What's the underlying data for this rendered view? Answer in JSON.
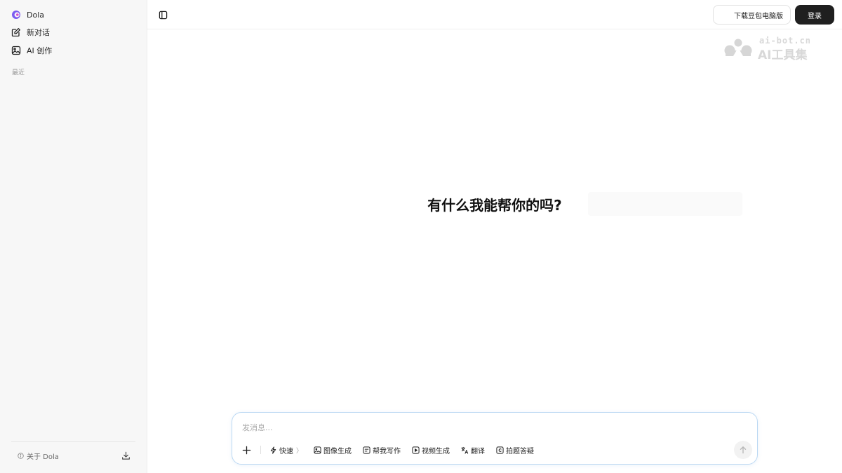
{
  "sidebar": {
    "logo_label": "Dola",
    "new_chat_label": "新对话",
    "ai_create_label": "AI 创作",
    "recent_label": "最近",
    "about_label": "关于 Dola"
  },
  "header": {
    "download_label": "下载豆包电脑版",
    "login_label": "登录"
  },
  "watermark": {
    "url": "ai-bot.cn",
    "title": "AI工具集"
  },
  "main": {
    "greeting": "有什么我能帮你的吗?"
  },
  "composer": {
    "placeholder": "发消息...",
    "tools": [
      {
        "label": "快速",
        "icon": "lightning-icon"
      },
      {
        "label": "图像生成",
        "icon": "image-icon"
      },
      {
        "label": "帮我写作",
        "icon": "write-icon"
      },
      {
        "label": "视频生成",
        "icon": "video-icon"
      },
      {
        "label": "翻译",
        "icon": "translate-icon"
      },
      {
        "label": "拍题答疑",
        "icon": "photo-question-icon"
      }
    ]
  },
  "colors": {
    "sidebar_bg": "#f7f7f7",
    "login_bg": "#1f1f1f",
    "composer_border": "#bcd9f3",
    "logo_purple": "#7b5cf0"
  }
}
